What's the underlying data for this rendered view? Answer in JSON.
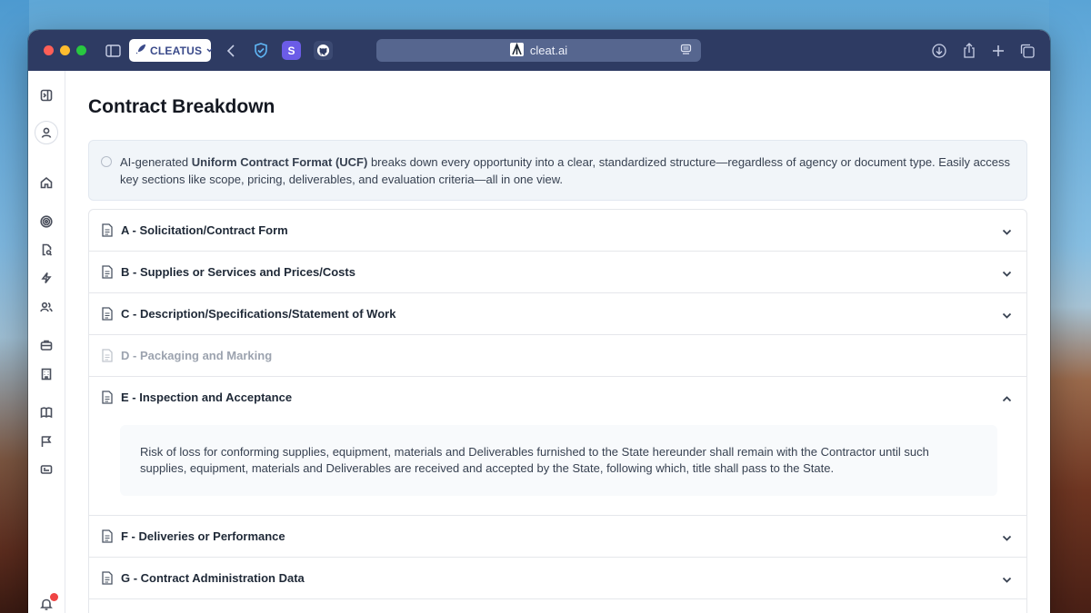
{
  "browser": {
    "tab_group_label": "CLEATUS",
    "url": "cleat.ai"
  },
  "colors": {
    "titlebar": "#2e3b63",
    "url_bar": "#56668f",
    "accent": "#3a4a8a",
    "notification": "#ef4444"
  },
  "sidebar": {
    "icons": [
      "toggle-sidebar-icon",
      "user-icon",
      "home-icon",
      "target-icon",
      "document-search-icon",
      "lightning-icon",
      "users-icon",
      "briefcase-icon",
      "building-icon",
      "book-icon",
      "flag-icon",
      "id-card-icon",
      "bell-icon"
    ]
  },
  "page": {
    "title": "Contract Breakdown",
    "info": {
      "prefix": "AI-generated ",
      "bold": "Uniform Contract Format (UCF)",
      "suffix": " breaks down every opportunity into a clear, standardized structure—regardless of agency or document type. Easily access key sections like scope, pricing, deliverables, and evaluation criteria—all in one view."
    },
    "sections": [
      {
        "label": "A - Solicitation/Contract Form",
        "expanded": false,
        "disabled": false
      },
      {
        "label": "B - Supplies or Services and Prices/Costs",
        "expanded": false,
        "disabled": false
      },
      {
        "label": "C - Description/Specifications/Statement of Work",
        "expanded": false,
        "disabled": false
      },
      {
        "label": "D - Packaging and Marking",
        "expanded": false,
        "disabled": true
      },
      {
        "label": "E - Inspection and Acceptance",
        "expanded": true,
        "disabled": false,
        "body": "Risk of loss for conforming supplies, equipment, materials and Deliverables furnished to the State hereunder shall remain with the Contractor until such supplies, equipment, materials and Deliverables are received and accepted by the State, following which, title shall pass to the State."
      },
      {
        "label": "F - Deliveries or Performance",
        "expanded": false,
        "disabled": false
      },
      {
        "label": "G - Contract Administration Data",
        "expanded": false,
        "disabled": false
      }
    ]
  }
}
